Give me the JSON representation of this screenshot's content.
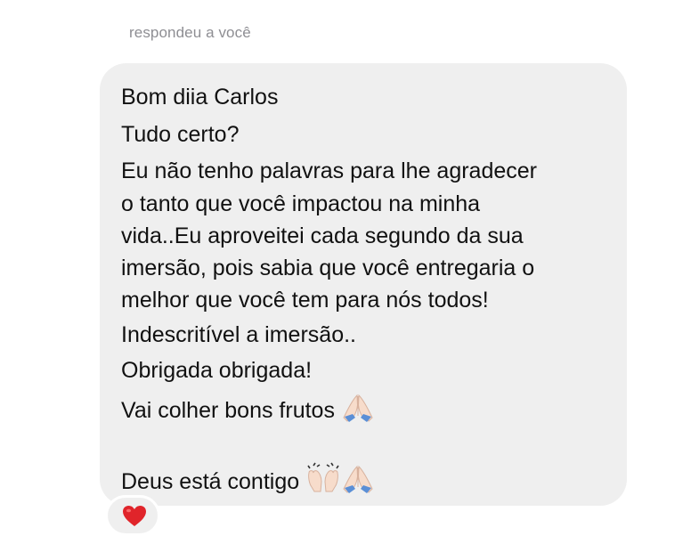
{
  "reply": {
    "label": "respondeu a você"
  },
  "message": {
    "lines": [
      "Bom diia Carlos",
      "Tudo certo?",
      "Eu não tenho palavras para lhe agradecer",
      "o tanto que você impactou na minha",
      "vida..Eu aproveitei cada segundo da sua",
      "imersão, pois sabia que você entregaria o",
      "melhor que você tem para nós todos!",
      "Indescritível a imersão..",
      "Obrigada obrigada!",
      "Vai colher bons frutos",
      "Deus está contigo"
    ],
    "emojis": {
      "line10": [
        "folded-hands-icon"
      ],
      "line11": [
        "raising-hands-icon",
        "folded-hands-icon"
      ]
    }
  },
  "reaction": {
    "icon": "red-heart-icon",
    "color": "#e0242a"
  },
  "colors": {
    "bubble": "#efefef",
    "text": "#111111",
    "secondary": "#8e8e93",
    "background": "#ffffff"
  }
}
